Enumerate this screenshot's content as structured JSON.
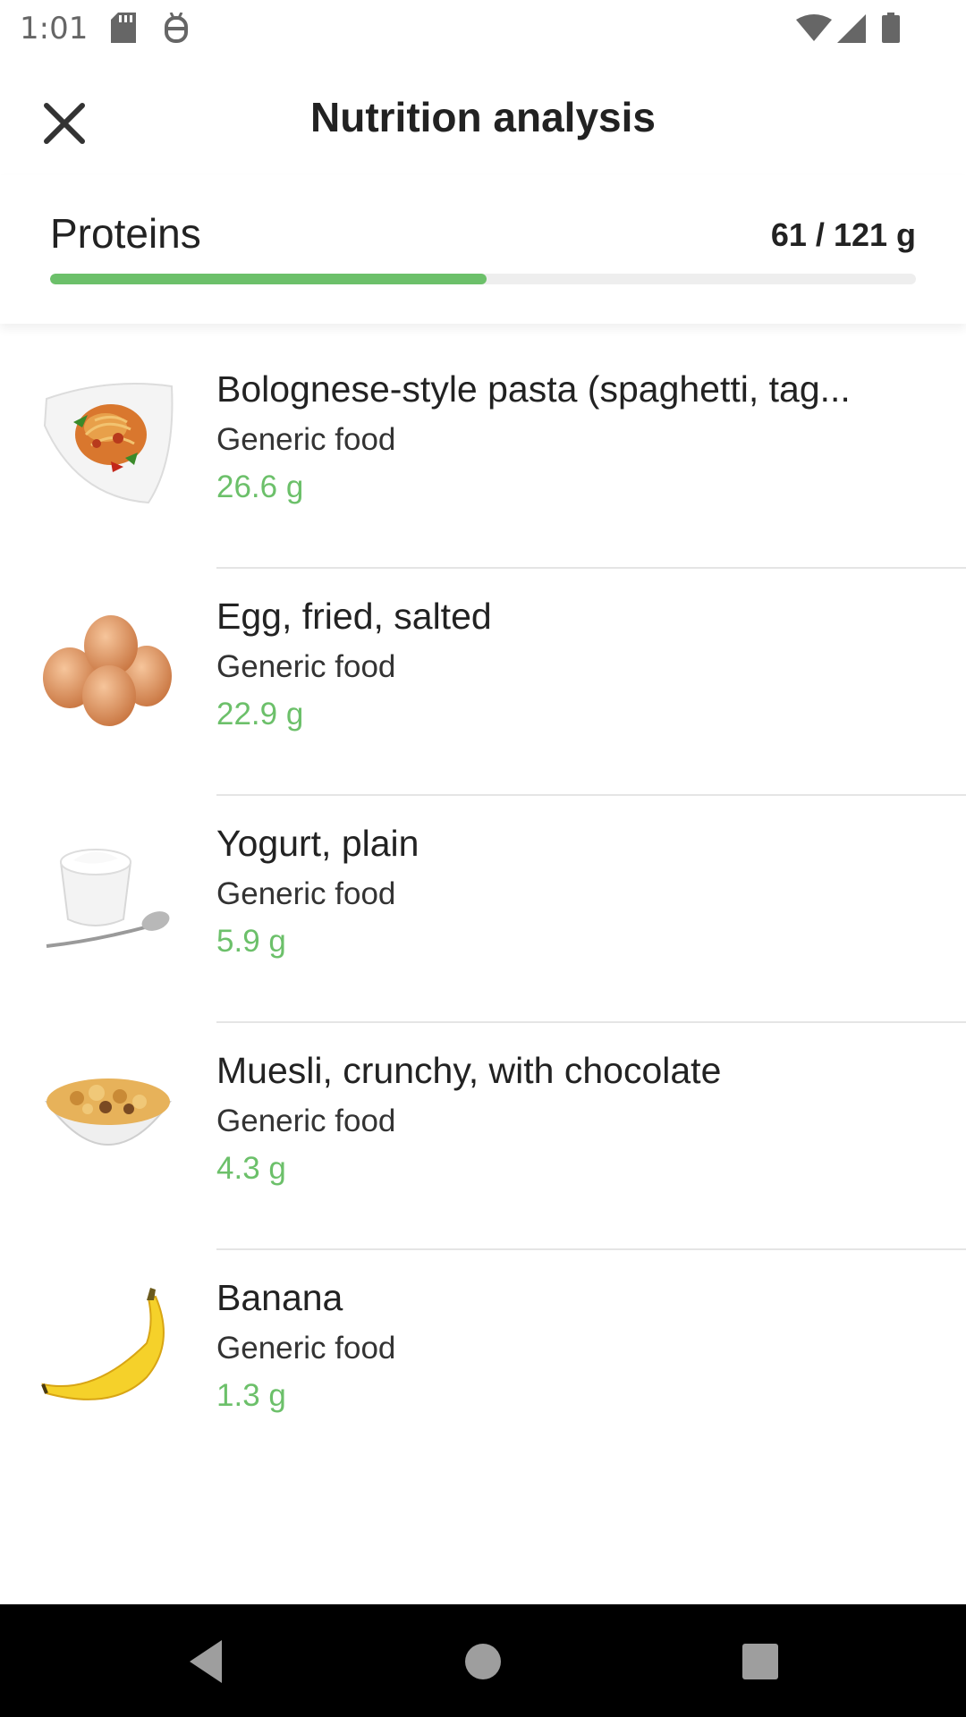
{
  "status_bar": {
    "time": "1:01",
    "icons": [
      "sd-card-icon",
      "debug-icon",
      "wifi-icon",
      "signal-icon",
      "battery-icon"
    ]
  },
  "header": {
    "title": "Nutrition analysis",
    "close_icon": "close-icon"
  },
  "summary": {
    "nutrient": "Proteins",
    "value_text": "61 / 121 g",
    "consumed": 61,
    "goal": 121,
    "unit": "g",
    "accent_color": "#6cc06a"
  },
  "foods": [
    {
      "name": "Bolognese-style pasta (spaghetti, tag...",
      "category": "Generic food",
      "amount": "26.6 g",
      "image": "pasta-plate"
    },
    {
      "name": "Egg, fried, salted",
      "category": "Generic food",
      "amount": "22.9 g",
      "image": "eggs"
    },
    {
      "name": "Yogurt, plain",
      "category": "Generic food",
      "amount": "5.9 g",
      "image": "yogurt-cup-spoon"
    },
    {
      "name": "Muesli, crunchy, with chocolate",
      "category": "Generic food",
      "amount": "4.3 g",
      "image": "muesli-bowl"
    },
    {
      "name": "Banana",
      "category": "Generic food",
      "amount": "1.3 g",
      "image": "banana"
    }
  ],
  "nav_bar": {
    "icons": [
      "back-icon",
      "home-icon",
      "recents-icon"
    ]
  }
}
